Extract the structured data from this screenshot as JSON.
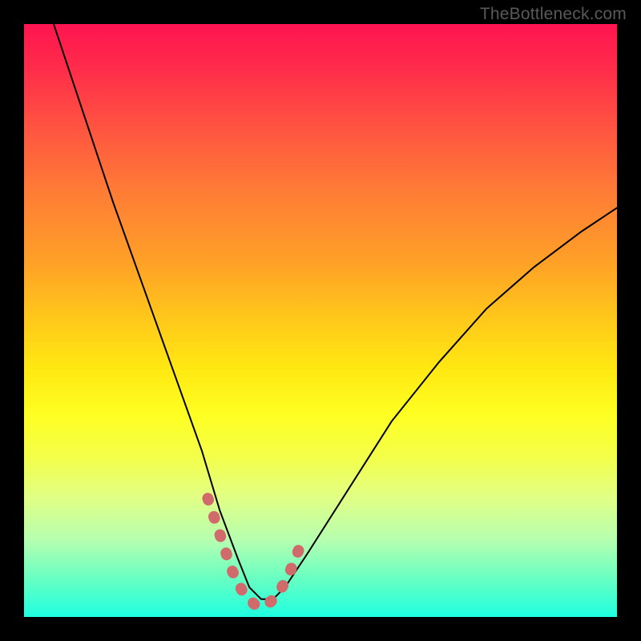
{
  "watermark": "TheBottleneck.com",
  "chart_data": {
    "type": "line",
    "title": "",
    "xlabel": "",
    "ylabel": "",
    "xlim": [
      0,
      100
    ],
    "ylim": [
      0,
      100
    ],
    "grid": false,
    "note": "Axes are unlabeled in source. x approximates a component index, y approximates bottleneck percentage. Values estimated from pixel positions.",
    "series": [
      {
        "name": "bottleneck-curve",
        "type": "line",
        "color": "#000000",
        "x": [
          5,
          10,
          15,
          20,
          25,
          30,
          33,
          36,
          38,
          40,
          42,
          44,
          48,
          55,
          62,
          70,
          78,
          86,
          94,
          100
        ],
        "y": [
          100,
          85,
          70,
          56,
          42,
          28,
          18,
          10,
          5,
          3,
          3,
          5,
          11,
          22,
          33,
          43,
          52,
          59,
          65,
          69
        ]
      },
      {
        "name": "highlighted-minimum",
        "type": "line",
        "color": "#d16b6b",
        "stroke_width": 12,
        "x": [
          31,
          33,
          35,
          37,
          39,
          41,
          43,
          45,
          47
        ],
        "y": [
          20,
          14,
          8,
          4,
          2,
          2,
          4,
          8,
          13
        ]
      }
    ],
    "background_gradient": {
      "type": "vertical",
      "stops": [
        {
          "pos": 0.0,
          "color": "#ff1450"
        },
        {
          "pos": 0.18,
          "color": "#ff5640"
        },
        {
          "pos": 0.4,
          "color": "#ffa027"
        },
        {
          "pos": 0.58,
          "color": "#ffe812"
        },
        {
          "pos": 0.73,
          "color": "#f4ff4a"
        },
        {
          "pos": 0.87,
          "color": "#b6ffb0"
        },
        {
          "pos": 1.0,
          "color": "#1effe0"
        }
      ]
    }
  }
}
